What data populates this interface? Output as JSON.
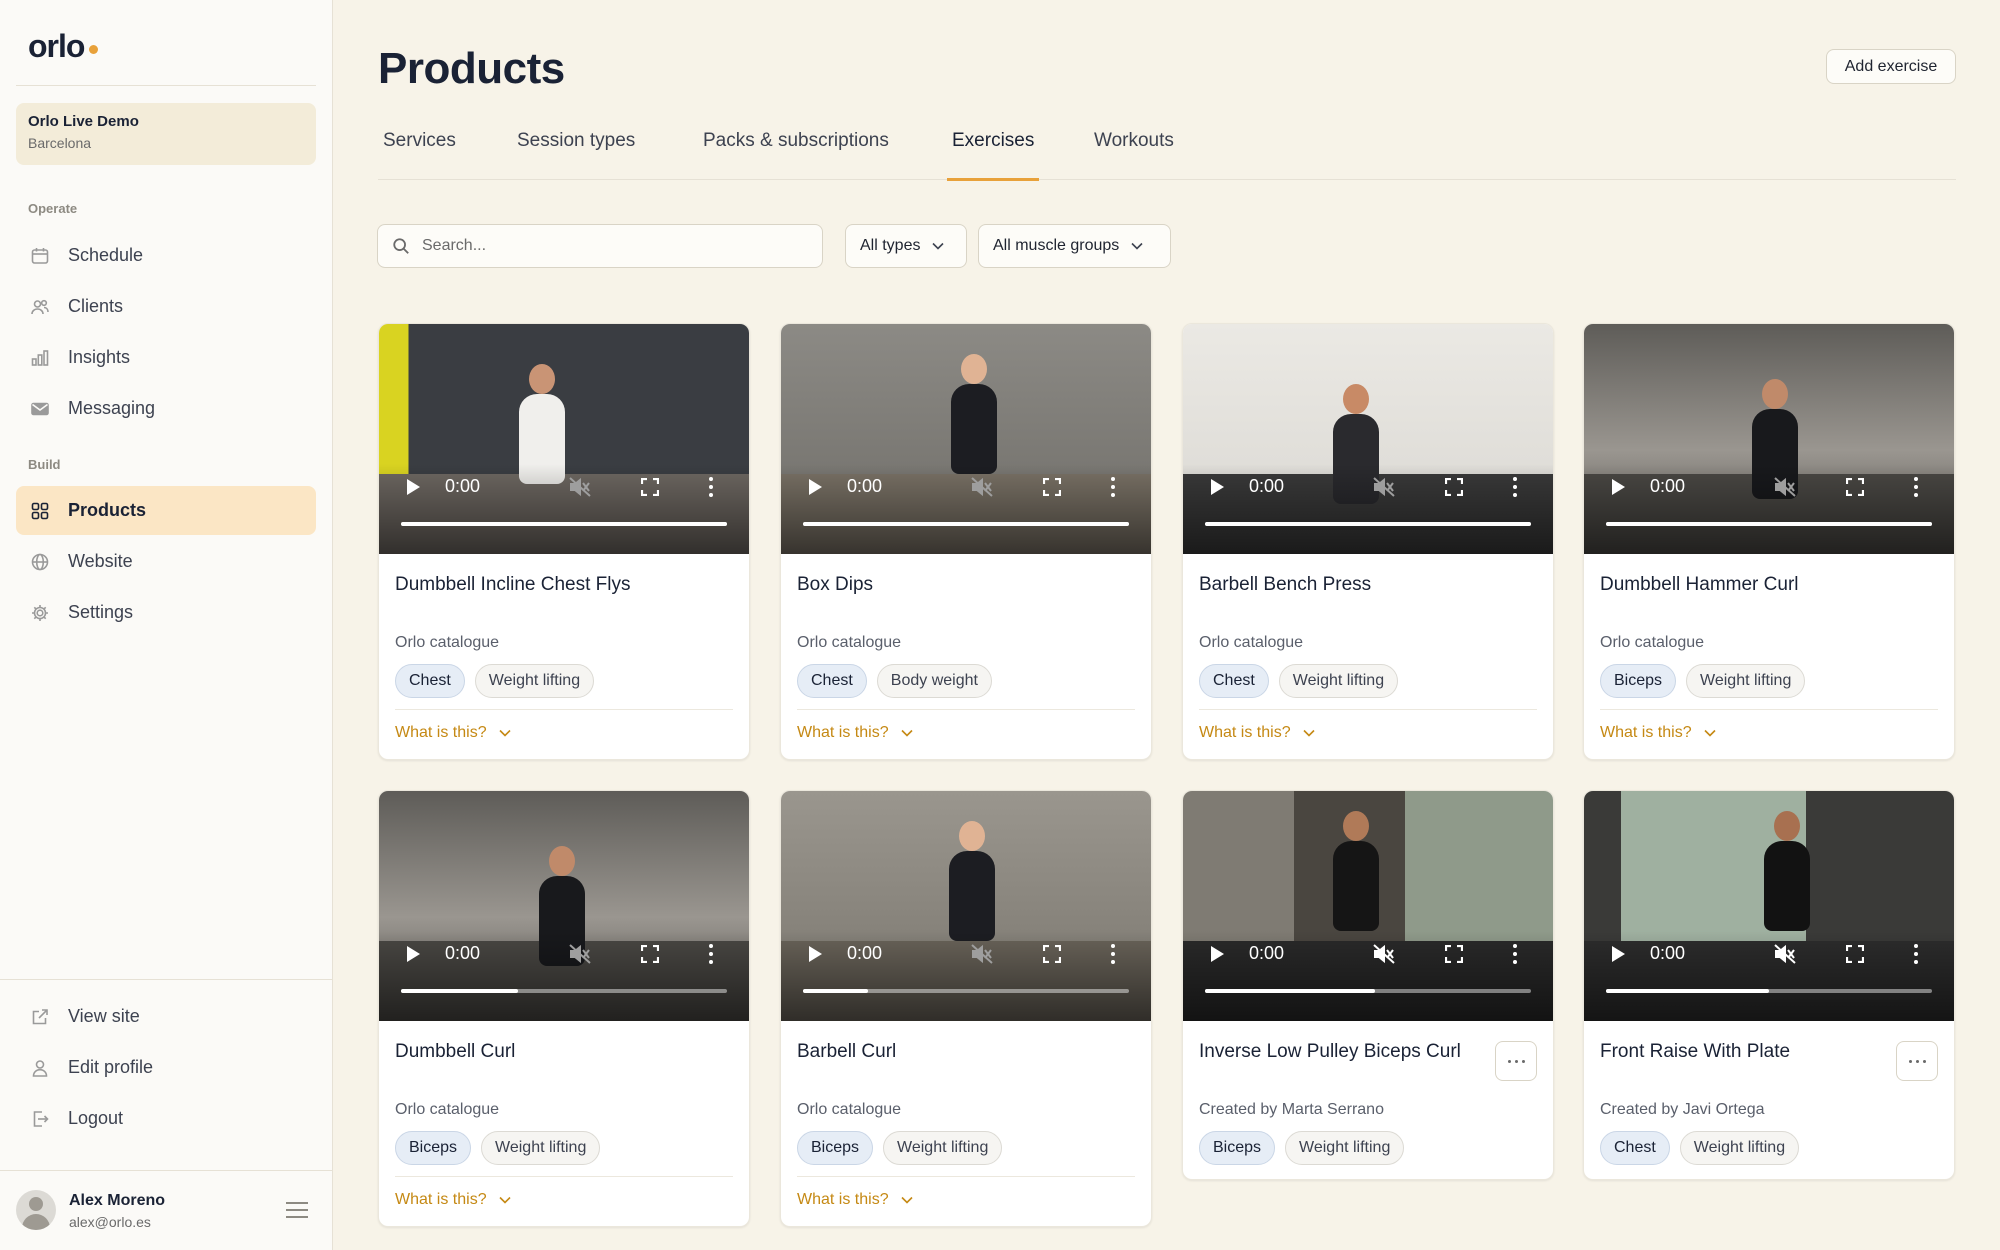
{
  "app": {
    "logo": "orlo",
    "accent": "#e8a13a"
  },
  "org": {
    "name": "Orlo Live Demo",
    "city": "Barcelona"
  },
  "sidebar": {
    "operate_label": "Operate",
    "build_label": "Build",
    "items": [
      {
        "label": "Schedule",
        "icon": "calendar-icon"
      },
      {
        "label": "Clients",
        "icon": "users-icon"
      },
      {
        "label": "Insights",
        "icon": "bar-chart-icon"
      },
      {
        "label": "Messaging",
        "icon": "mail-icon"
      },
      {
        "label": "Products",
        "icon": "grid-icon",
        "active": true
      },
      {
        "label": "Website",
        "icon": "globe-icon"
      },
      {
        "label": "Settings",
        "icon": "gear-icon"
      }
    ],
    "bottom_items": [
      {
        "label": "View site",
        "icon": "external-link-icon"
      },
      {
        "label": "Edit profile",
        "icon": "user-icon"
      },
      {
        "label": "Logout",
        "icon": "logout-icon"
      }
    ]
  },
  "user": {
    "name": "Alex Moreno",
    "email": "alex@orlo.es"
  },
  "header": {
    "title": "Products",
    "add_button": "Add exercise"
  },
  "tabs": [
    {
      "label": "Services"
    },
    {
      "label": "Session types"
    },
    {
      "label": "Packs & subscriptions"
    },
    {
      "label": "Exercises",
      "active": true
    },
    {
      "label": "Workouts"
    }
  ],
  "filters": {
    "search_placeholder": "Search...",
    "type": "All types",
    "muscle": "All muscle groups"
  },
  "video_time": "0:00",
  "what_is_this": "What is this?",
  "cards": [
    {
      "title": "Dumbbell Incline Chest Flys",
      "source": "Orlo catalogue",
      "tags": [
        "Chest",
        "Weight lifting"
      ],
      "progress": 1.0
    },
    {
      "title": "Box Dips",
      "source": "Orlo catalogue",
      "tags": [
        "Chest",
        "Body weight"
      ],
      "progress": 1.0
    },
    {
      "title": "Barbell Bench Press",
      "source": "Orlo catalogue",
      "tags": [
        "Chest",
        "Weight lifting"
      ],
      "progress": 1.0
    },
    {
      "title": "Dumbbell Hammer Curl",
      "source": "Orlo catalogue",
      "tags": [
        "Biceps",
        "Weight lifting"
      ],
      "progress": 1.0
    },
    {
      "title": "Dumbbell Curl",
      "source": "Orlo catalogue",
      "tags": [
        "Biceps",
        "Weight lifting"
      ],
      "progress": 0.36
    },
    {
      "title": "Barbell Curl",
      "source": "Orlo catalogue",
      "tags": [
        "Biceps",
        "Weight lifting"
      ],
      "progress": 0.2
    },
    {
      "title": "Inverse Low Pulley Biceps Curl",
      "source": "Created by Marta Serrano",
      "tags": [
        "Biceps",
        "Weight lifting"
      ],
      "progress": 0.52
    },
    {
      "title": "Front Raise With Plate",
      "source": "Created by Javi Ortega",
      "tags": [
        "Chest",
        "Weight lifting"
      ],
      "progress": 0.5
    }
  ]
}
